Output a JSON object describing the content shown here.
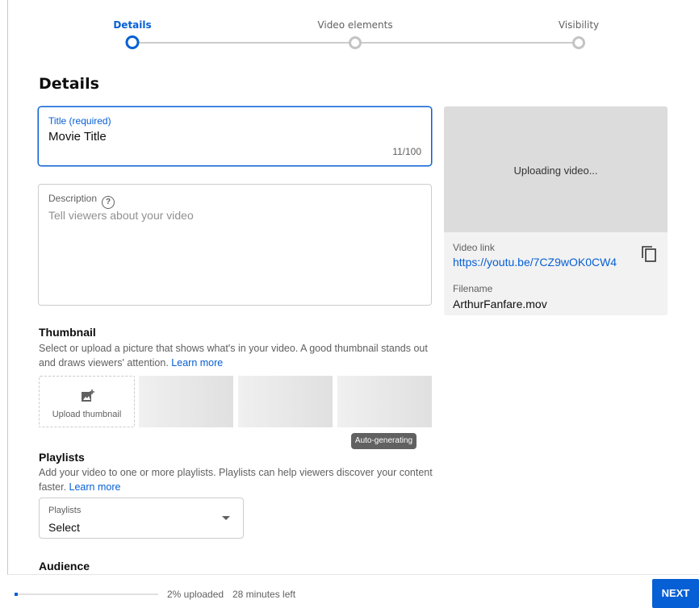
{
  "stepper": {
    "steps": [
      {
        "label": "Details",
        "active": true
      },
      {
        "label": "Video elements",
        "active": false
      },
      {
        "label": "Visibility",
        "active": false
      }
    ]
  },
  "page_title": "Details",
  "title_field": {
    "label": "Title (required)",
    "value": "Movie Title",
    "counter": "11/100"
  },
  "description_field": {
    "label": "Description",
    "placeholder": "Tell viewers about your video"
  },
  "preview": {
    "status": "Uploading video...",
    "video_link_label": "Video link",
    "video_link": "https://youtu.be/7CZ9wOK0CW4",
    "filename_label": "Filename",
    "filename": "ArthurFanfare.mov"
  },
  "thumbnail": {
    "title": "Thumbnail",
    "description": "Select or upload a picture that shows what's in your video. A good thumbnail stands out and draws viewers' attention.",
    "learn_more": "Learn more",
    "upload_label": "Upload thumbnail",
    "tooltip": "Auto-generating"
  },
  "playlists": {
    "title": "Playlists",
    "description": "Add your video to one or more playlists. Playlists can help viewers discover your content faster.",
    "learn_more": "Learn more",
    "select_label": "Playlists",
    "select_value": "Select"
  },
  "audience": {
    "title": "Audience"
  },
  "footer": {
    "progress_fraction": 0.02,
    "uploaded_text": "2% uploaded",
    "time_left": "28 minutes left",
    "next_label": "NEXT"
  },
  "colors": {
    "accent": "#065fd4"
  }
}
